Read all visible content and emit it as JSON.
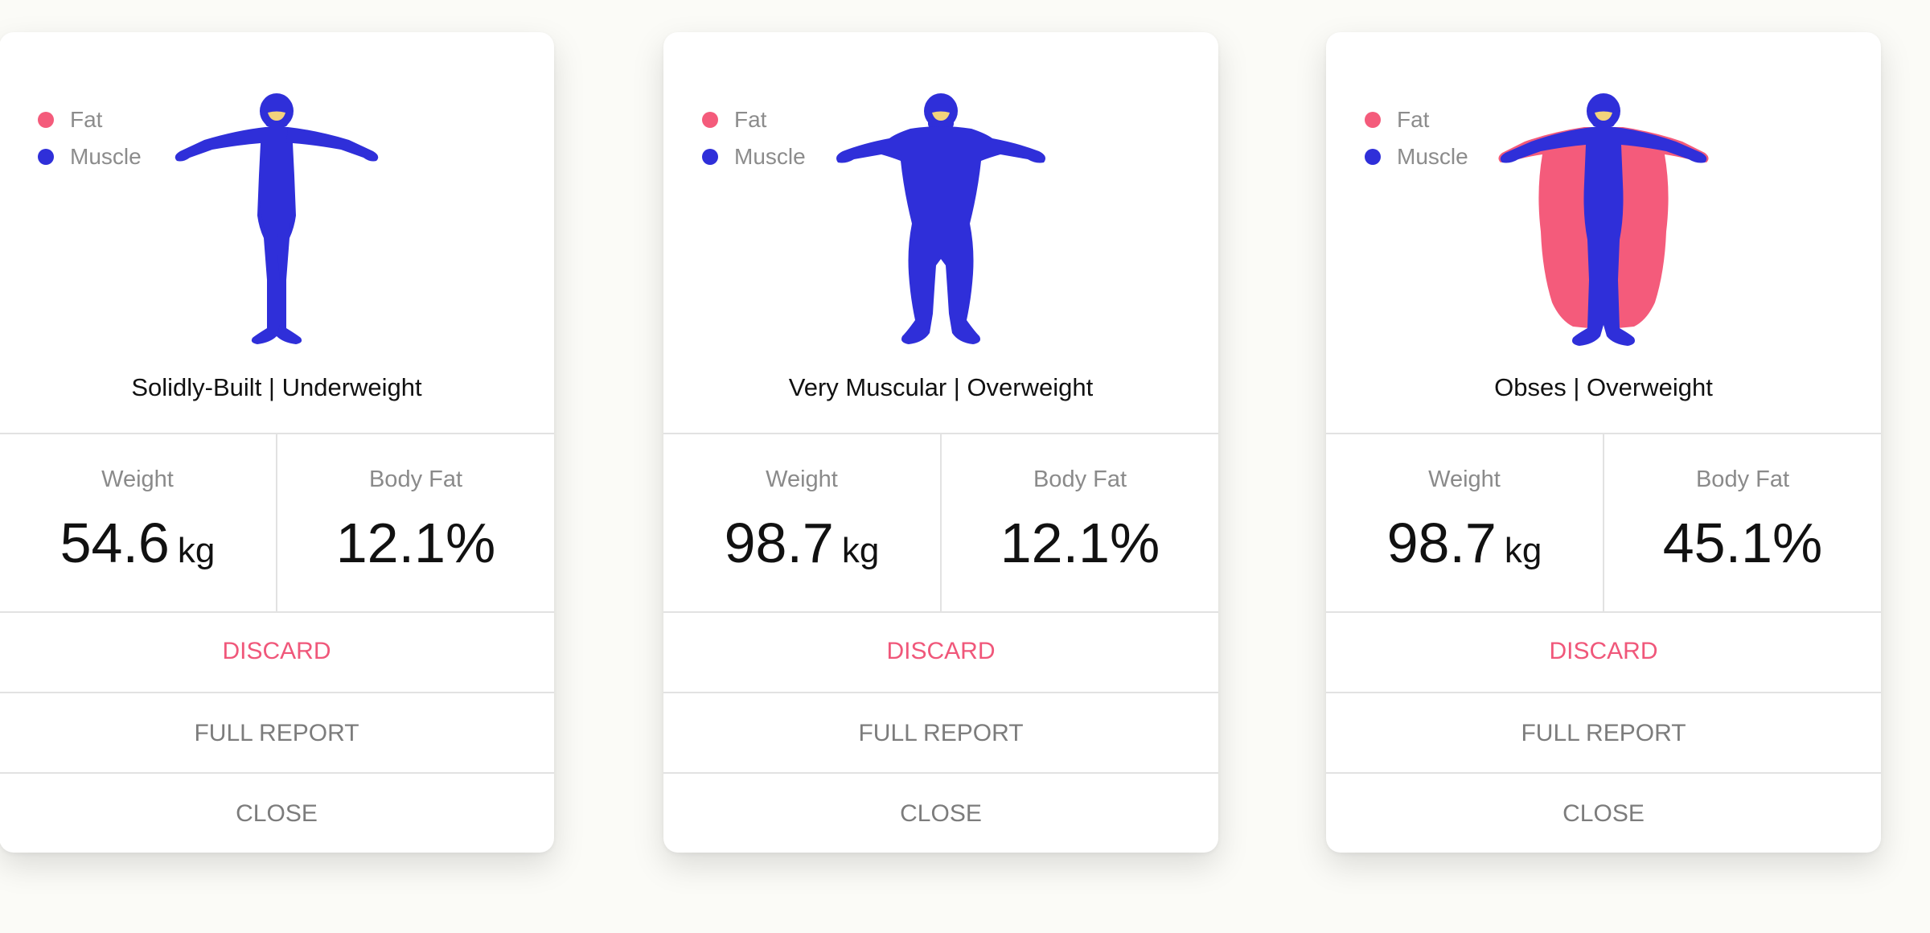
{
  "colors": {
    "fat": "#f45b7b",
    "muscle": "#2f2fd9",
    "face": "#f3d37c",
    "discard": "#f0577a"
  },
  "cards": [
    {
      "legend": {
        "fat": "Fat",
        "muscle": "Muscle"
      },
      "figure_icon": "body-figure-solidly-built",
      "classification": "Solidly-Built | Underweight",
      "weight": {
        "label": "Weight",
        "value": "54.6",
        "unit": "kg"
      },
      "body_fat": {
        "label": "Body Fat",
        "value": "12.1%"
      },
      "actions": {
        "discard": "DISCARD",
        "report": "FULL REPORT",
        "close": "CLOSE"
      }
    },
    {
      "legend": {
        "fat": "Fat",
        "muscle": "Muscle"
      },
      "figure_icon": "body-figure-very-muscular",
      "classification": "Very Muscular | Overweight",
      "weight": {
        "label": "Weight",
        "value": "98.7",
        "unit": "kg"
      },
      "body_fat": {
        "label": "Body Fat",
        "value": "12.1%"
      },
      "actions": {
        "discard": "DISCARD",
        "report": "FULL REPORT",
        "close": "CLOSE"
      }
    },
    {
      "legend": {
        "fat": "Fat",
        "muscle": "Muscle"
      },
      "figure_icon": "body-figure-obese",
      "classification": "Obses | Overweight",
      "weight": {
        "label": "Weight",
        "value": "98.7",
        "unit": "kg"
      },
      "body_fat": {
        "label": "Body Fat",
        "value": "45.1%"
      },
      "actions": {
        "discard": "DISCARD",
        "report": "FULL REPORT",
        "close": "CLOSE"
      }
    }
  ]
}
